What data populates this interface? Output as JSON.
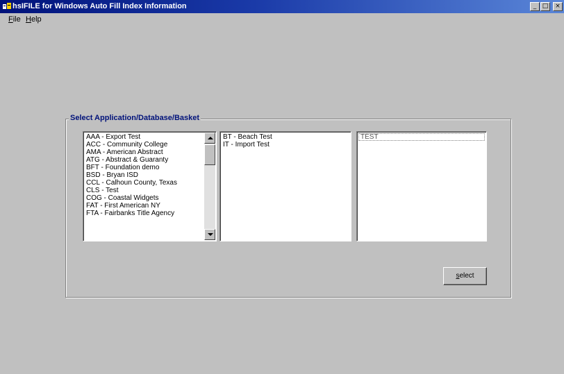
{
  "window": {
    "title": "hsIFILE for Windows Auto Fill Index Information",
    "minimize_glyph": "_",
    "maximize_glyph": "□",
    "close_glyph": "×"
  },
  "menu": [
    {
      "accel": "F",
      "rest": "ile"
    },
    {
      "accel": "H",
      "rest": "elp"
    }
  ],
  "group": {
    "label": "Select Application/Database/Basket"
  },
  "applications": [
    "AAA - Export Test",
    "ACC - Community College",
    "AMA - American Abstract",
    "ATG - Abstract & Guaranty",
    "BFT - Foundation demo",
    "BSD - Bryan ISD",
    "CCL - Calhoun County, Texas",
    "CLS - Test",
    "COG - Coastal Widgets",
    "FAT - First American NY",
    "FTA - Fairbanks Title Agency"
  ],
  "databases": [
    "BT - Beach Test",
    "IT - Import Test"
  ],
  "baskets": [
    "TEST"
  ],
  "select_button": {
    "accel": "s",
    "rest": "elect"
  },
  "colors": {
    "titlebar_start": "#00127a",
    "titlebar_end": "#5a86d8",
    "group_label": "#00127a",
    "face": "#c0c0c0"
  }
}
